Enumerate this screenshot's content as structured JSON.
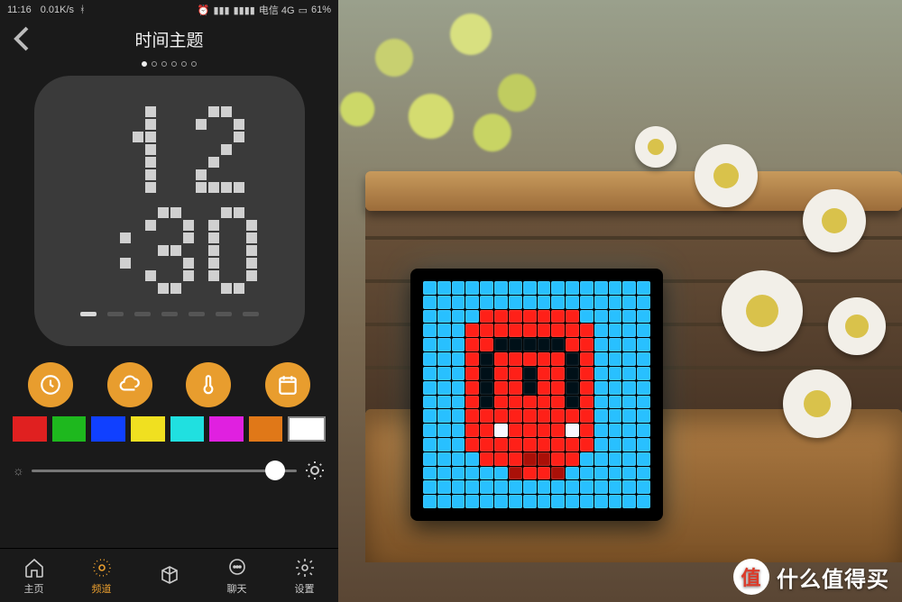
{
  "status_bar": {
    "time": "11:16",
    "net_speed": "0.01K/s",
    "carrier": "电信 4G",
    "battery": "61%"
  },
  "header": {
    "title": "时间主题"
  },
  "pager": {
    "count": 6,
    "active": 0
  },
  "clock": {
    "display_time": "12:30",
    "date_dashes": 7,
    "date_active": 0
  },
  "func": {
    "clock": "clock-icon",
    "cloud": "cloud-icon",
    "temp": "thermometer-icon",
    "calendar": "calendar-icon"
  },
  "palette": [
    "#e02020",
    "#1eb81e",
    "#1040ff",
    "#f0e020",
    "#20e0e0",
    "#e020e0",
    "#e07818",
    "#ffffff"
  ],
  "brightness_percent": 92,
  "nav": {
    "items": [
      {
        "key": "home",
        "label": "主页"
      },
      {
        "key": "channel",
        "label": "频道"
      },
      {
        "key": "box",
        "label": ""
      },
      {
        "key": "chat",
        "label": "聊天"
      },
      {
        "key": "settings",
        "label": "设置"
      }
    ],
    "active": 1
  },
  "device": {
    "palette": {
      "bg": "#083040",
      "sky": "#28c0ff",
      "red": "#ff2018",
      "darkred": "#aa1008",
      "white": "#f8f8ff",
      "black": "#001018"
    }
  },
  "watermark": {
    "badge": "值",
    "text": "什么值得买"
  }
}
